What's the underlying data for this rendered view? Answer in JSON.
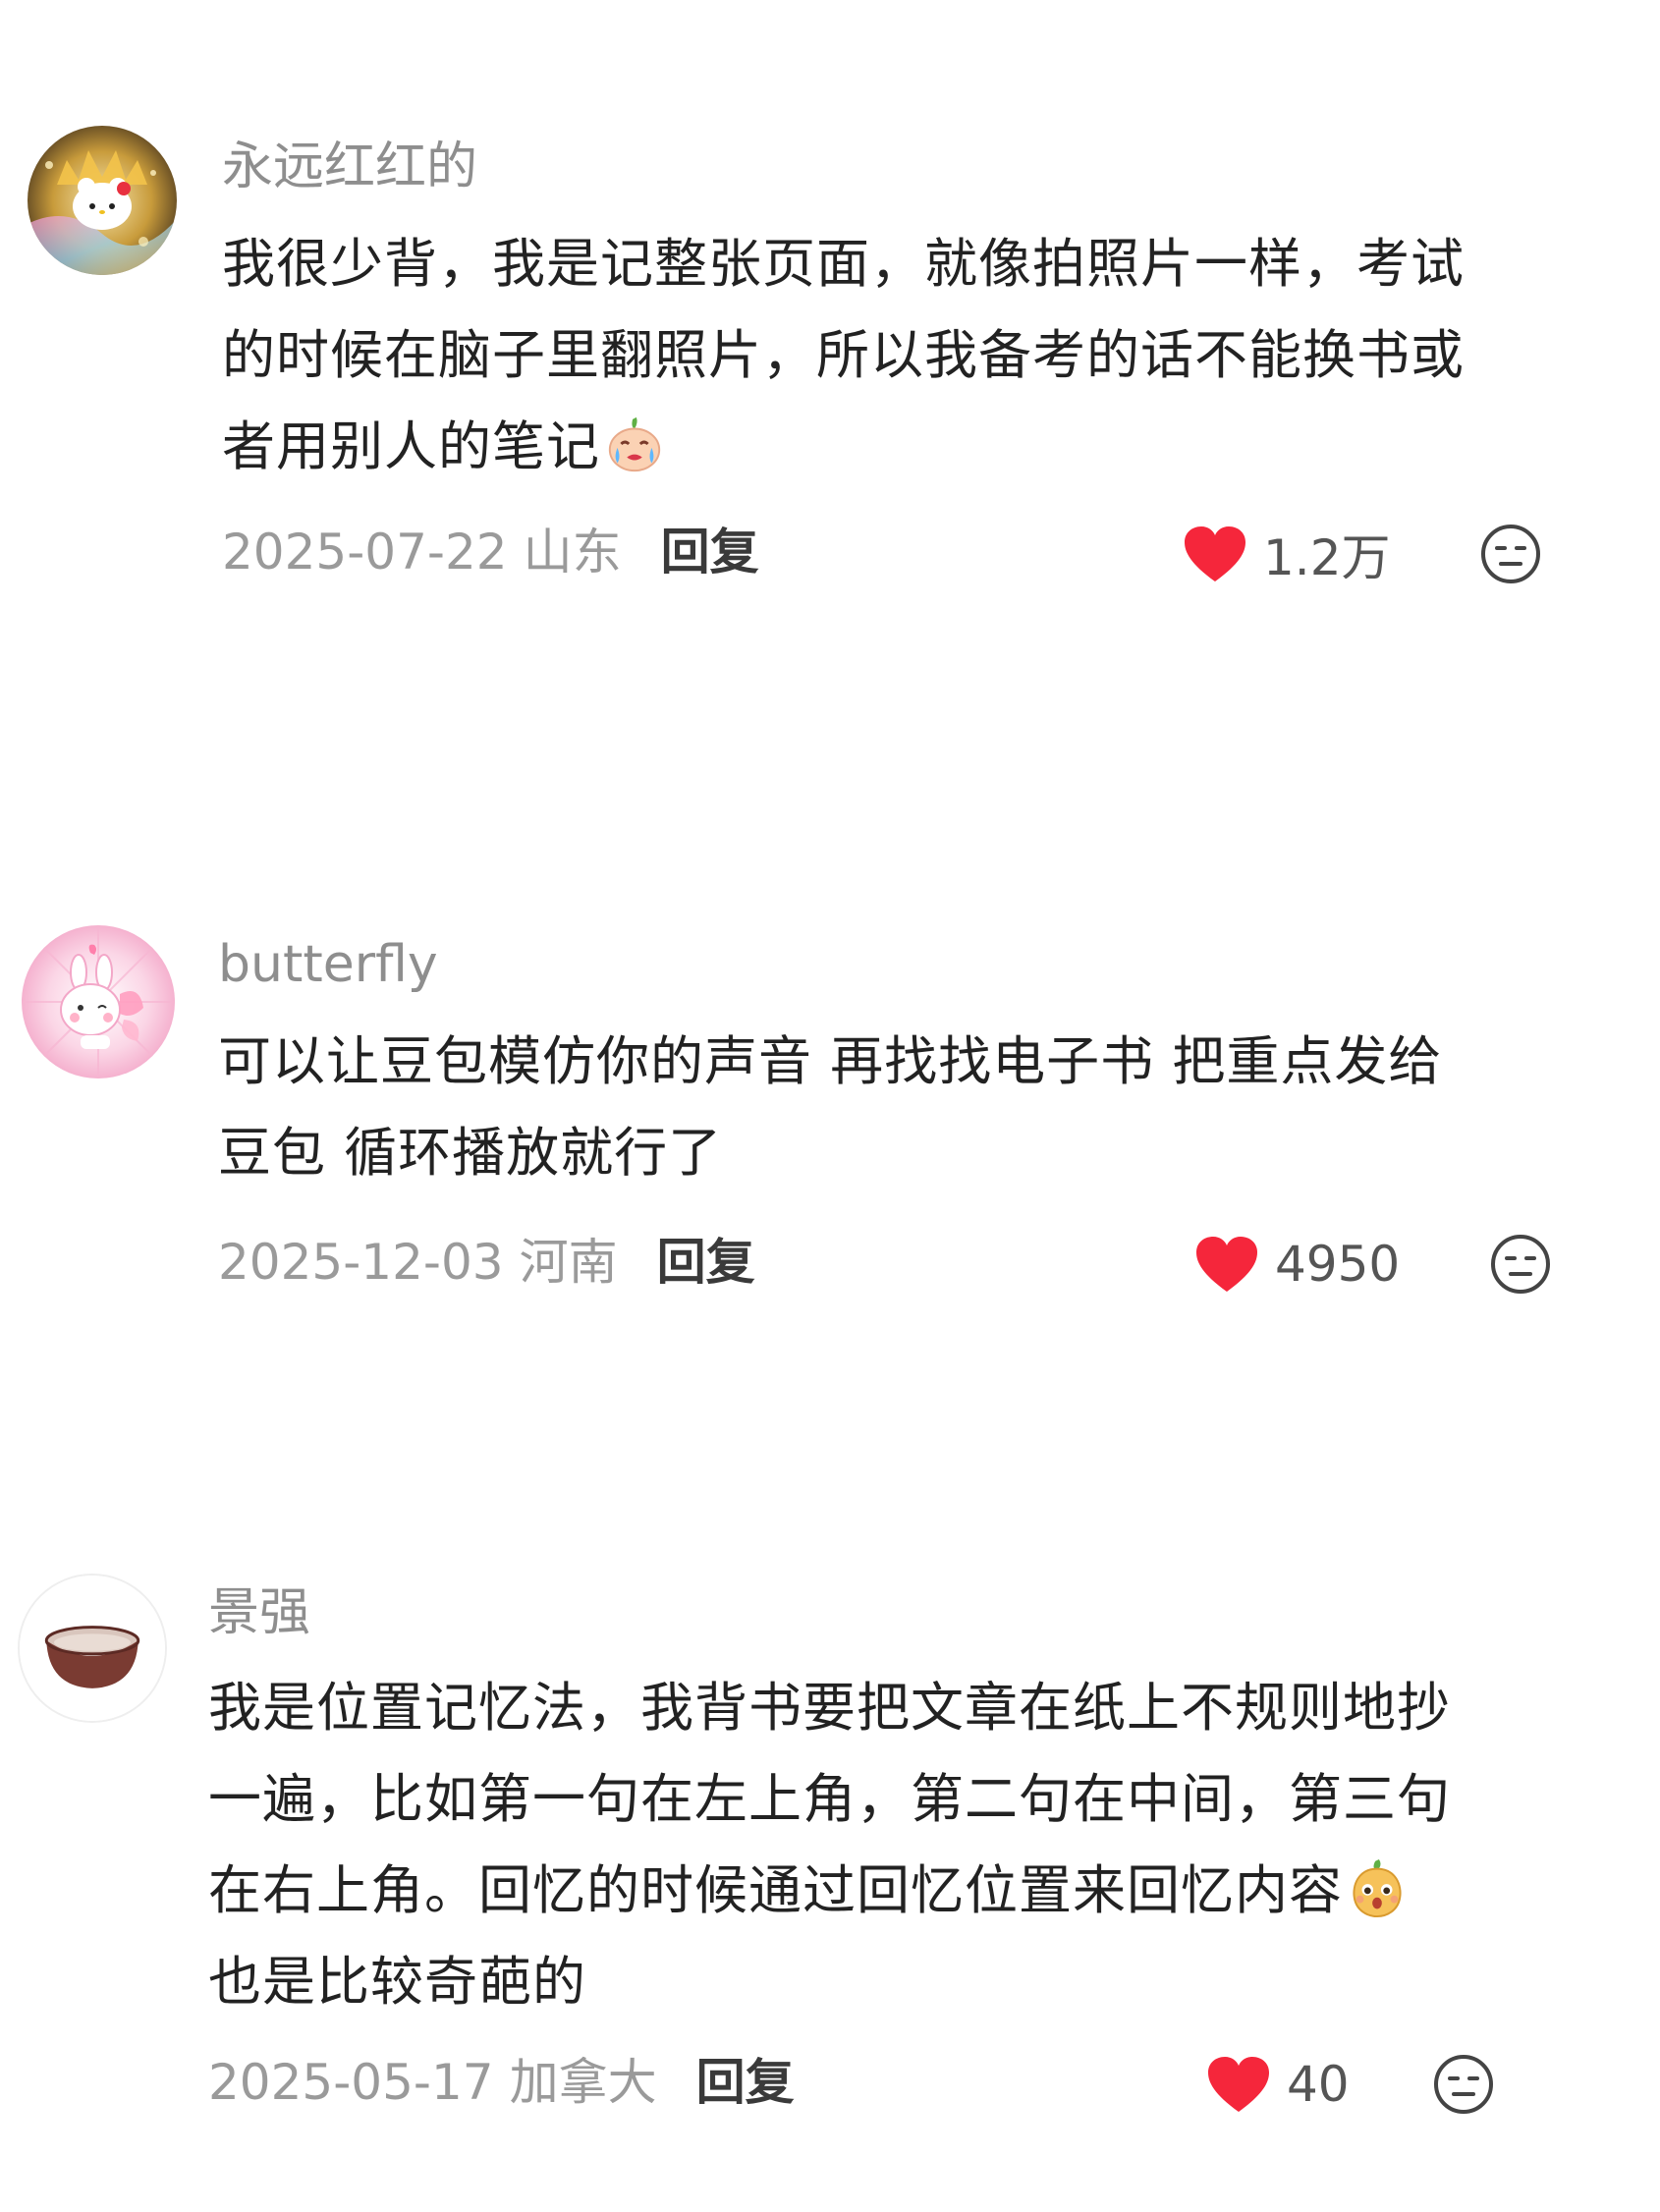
{
  "comments": [
    {
      "username": "永远红红的",
      "avatar_icon": "hello-kitty-gold-splash-avatar",
      "content_lines": [
        "我很少背，我是记整张页面，就像拍照片一样，考试",
        "的时候在脑子里翻照片，所以我备考的话不能换书或",
        "者用别人的笔记"
      ],
      "emoji_icon": "crying-face-emoji",
      "date": "2025-07-22",
      "location": "山东",
      "reply_label": "回复",
      "likes": "1.2万"
    },
    {
      "username": "butterfly",
      "avatar_icon": "pink-bunny-avatar",
      "content_lines": [
        "可以让豆包模仿你的声音 再找找电子书 把重点发给",
        "豆包 循环播放就行了"
      ],
      "date": "2025-12-03",
      "location": "河南",
      "reply_label": "回复",
      "likes": "4950"
    },
    {
      "username": "景强",
      "avatar_icon": "bowl-avatar",
      "content_lines": [
        "我是位置记忆法，我背书要把文章在纸上不规则地抄",
        "一遍，比如第一句在左上角，第二句在中间，第三句",
        "在右上角。回忆的时候通过回忆位置来回忆内容",
        "也是比较奇葩的"
      ],
      "emoji_icon": "surprised-peach-emoji",
      "date": "2025-05-17",
      "location": "加拿大",
      "reply_label": "回复",
      "likes": "40"
    }
  ],
  "colors": {
    "heart": "#f5263b",
    "username": "#8e8e8e",
    "meta": "#9a9a9a"
  },
  "icons": {
    "like": "heart-icon",
    "dislike": "meh-face-icon"
  }
}
